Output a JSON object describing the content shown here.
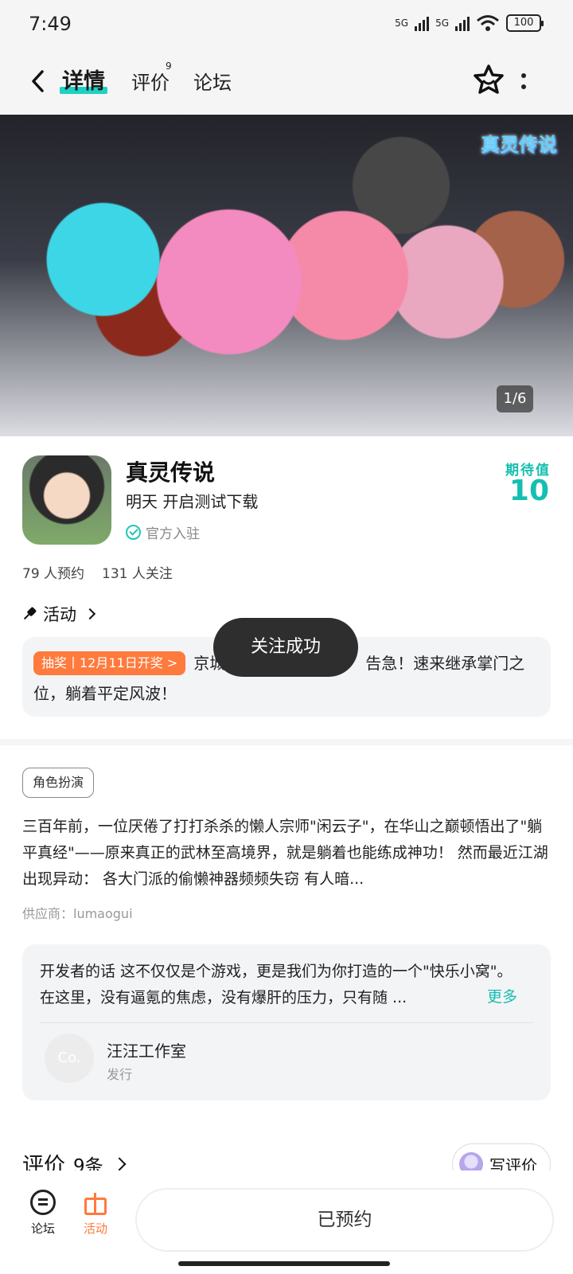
{
  "status_bar": {
    "time": "7:49",
    "network1": "5G",
    "network2": "5G",
    "battery": "100"
  },
  "nav": {
    "tabs": [
      {
        "label": "详情",
        "active": true
      },
      {
        "label": "评价",
        "badge": "9"
      },
      {
        "label": "论坛"
      }
    ],
    "back_icon": "chevron-left-icon",
    "favorite_icon": "star-icon",
    "more_icon": "more-vertical-icon"
  },
  "banner": {
    "logo_text": "真灵传说",
    "counter": "1/6"
  },
  "game": {
    "title": "真灵传说",
    "subtitle": "明天 开启测试下载",
    "official": "官方入驻",
    "expect_label": "期待值",
    "expect_value": "10",
    "reservations": "79 人预约",
    "followers": "131 人关注"
  },
  "activity": {
    "header": "活动",
    "tag": "抽奖丨12月11日开奖 >",
    "text_before": "京城",
    "text_after": "告急！速来继承掌门之位，躺着平定风波！"
  },
  "toast": "关注成功",
  "details": {
    "genre": "角色扮演",
    "description": "三百年前，一位厌倦了打打杀杀的懒人宗师\"闲云子\"，在华山之巅顿悟出了\"躺平真经\"——原来真正的武林至高境界，就是躺着也能练成神功！ 然而最近江湖出现异动： 各大门派的偷懒神器频频失窃 有人暗...",
    "supplier": "供应商：lumaogui"
  },
  "developer": {
    "text": "开发者的话  这不仅仅是个游戏，更是我们为你打造的一个\"快乐小窝\"。在这里，没有逼氪的焦虑，没有爆肝的压力，只有随 ...",
    "more": "更多",
    "avatar_text": "Co.",
    "name": "汪汪工作室",
    "role": "发行"
  },
  "reviews": {
    "title": "评价",
    "count": "9条",
    "write_label": "写评价"
  },
  "bottom_bar": {
    "forum_label": "论坛",
    "activity_label": "活动",
    "action_label": "已预约"
  },
  "colors": {
    "accent": "#15bfb0",
    "orange": "#ff7a3d",
    "toast_bg": "#2e2e2e"
  }
}
